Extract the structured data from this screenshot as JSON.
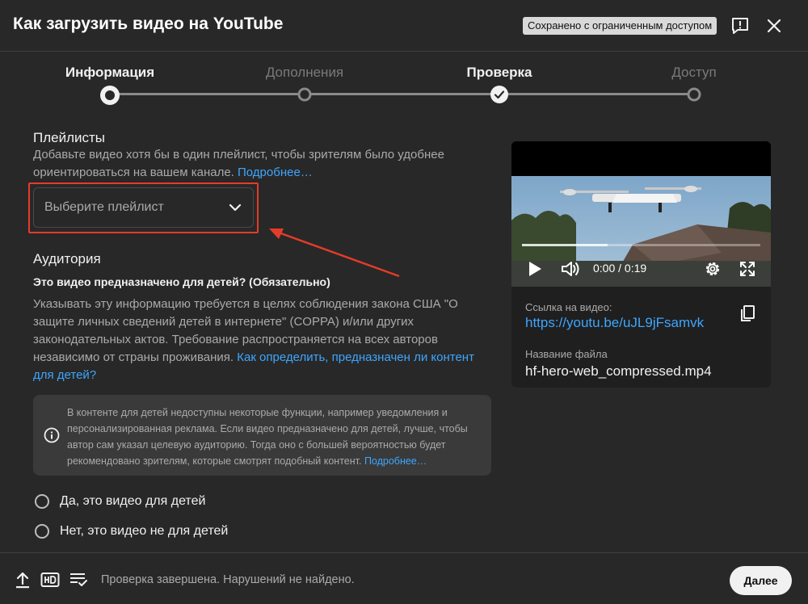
{
  "header": {
    "title": "Как загрузить видео на YouTube",
    "saved_badge": "Сохранено с ограниченным доступом"
  },
  "stepper": {
    "steps": [
      {
        "label": "Информация",
        "state": "current"
      },
      {
        "label": "Дополнения",
        "state": "upcoming"
      },
      {
        "label": "Проверка",
        "state": "done"
      },
      {
        "label": "Доступ",
        "state": "upcoming"
      }
    ]
  },
  "playlists": {
    "title": "Плейлисты",
    "description_line1": "Добавьте видео хотя бы в один плейлист, чтобы зрителям было удобнее",
    "description_line2": "ориентироваться на вашем канале.",
    "learn_more": "Подробнее…",
    "select_placeholder": "Выберите плейлист"
  },
  "audience": {
    "title": "Аудитория",
    "question": "Это видео предназначено для детей? (Обязательно)",
    "text_line1": "Указывать эту информацию требуется в целях соблюдения закона США \"О",
    "text_line2": "защите личных сведений детей в интернете\" (COPPA) и/или других",
    "text_line3": "законодательных актов. Требование распространяется на всех авторов",
    "text_line4": "независимо от страны проживания.",
    "link_part1": "Как определить, предназначен ли контент",
    "link_part2": "для детей?",
    "info_line1": "В контенте для детей недоступны некоторые функции, например уведомления и",
    "info_line2": "персонализированная реклама. Если видео предназначено для детей, лучше, чтобы",
    "info_line3": "автор сам указал целевую аудиторию. Тогда оно с большей вероятностью будет",
    "info_line4": "рекомендовано зрителям, которые смотрят подобный контент.",
    "info_link": "Подробнее…",
    "option_yes": "Да, это видео для детей",
    "option_no": "Нет, это видео не для детей"
  },
  "video": {
    "time": "0:00 / 0:19",
    "progress": 0.36,
    "link_label": "Ссылка на видео:",
    "link": "https://youtu.be/uJL9jFsamvk",
    "filename_label": "Название файла",
    "filename": "hf-hero-web_compressed.mp4"
  },
  "footer": {
    "status": "Проверка завершена. Нарушений не найдено.",
    "next_label": "Далее"
  },
  "colors": {
    "accent_link": "#3ea6ff",
    "highlight": "#e53b2a",
    "background": "#282828"
  }
}
